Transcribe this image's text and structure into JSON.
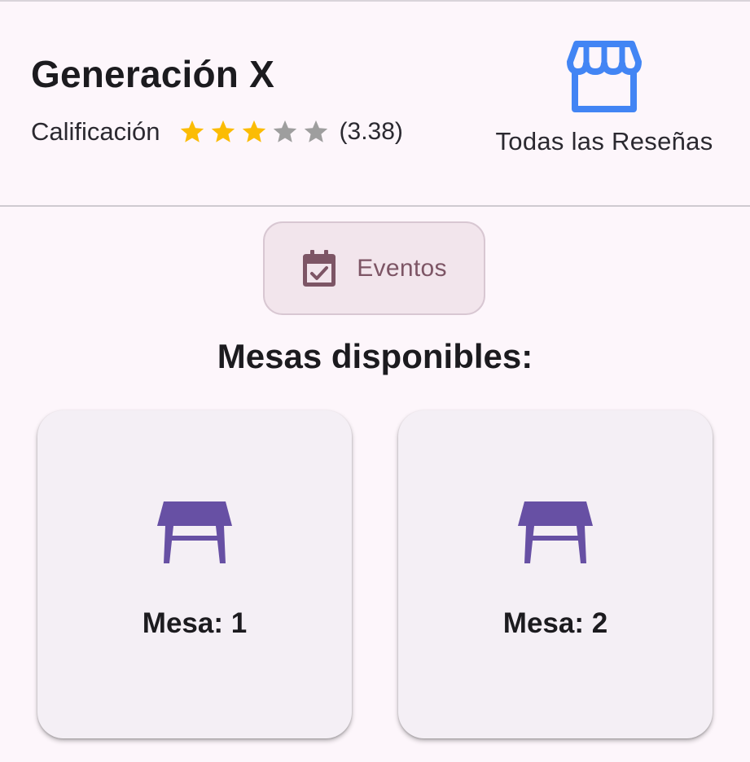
{
  "header": {
    "venue_name": "Generación X",
    "rating_label": "Calificación",
    "rating_value": 3.38,
    "rating_max": 5,
    "rating_count_text": "(3.38)",
    "reviews_label": "Todas las Reseñas",
    "reviews_icon": "storefront-icon"
  },
  "events_button": {
    "label": "Eventos",
    "icon": "calendar-check-icon"
  },
  "tables_section": {
    "title": "Mesas disponibles:",
    "tables": [
      {
        "label": "Mesa: 1",
        "icon": "table-icon"
      },
      {
        "label": "Mesa: 2",
        "icon": "table-icon"
      }
    ]
  },
  "colors": {
    "background": "#fdf6fb",
    "star_filled": "#fbbc04",
    "star_empty": "#9e9e9e",
    "store_icon": "#4285f4",
    "events_accent": "#7d5565",
    "table_icon": "#6750a4",
    "card_background": "#f4eff5"
  }
}
